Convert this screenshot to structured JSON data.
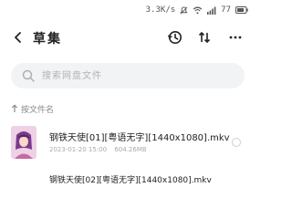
{
  "status_bar": {
    "net_speed": "3.3K/s",
    "battery": "77"
  },
  "header": {
    "title": "草集"
  },
  "search": {
    "placeholder": "搜索网盘文件"
  },
  "sort": {
    "label": "按文件名"
  },
  "files": [
    {
      "name": "钢铁天使[01][粤语无字][1440x1080].mkv",
      "date": "2023-01-20 15:00",
      "size": "604.26MB"
    },
    {
      "name": "钢铁天使[02][粤语无字][1440x1080].mkv"
    }
  ],
  "colors": {
    "background": "#ffffff",
    "search_bg": "#f2f3f5",
    "text_primary": "#222222",
    "text_secondary": "#aaaaaa"
  }
}
